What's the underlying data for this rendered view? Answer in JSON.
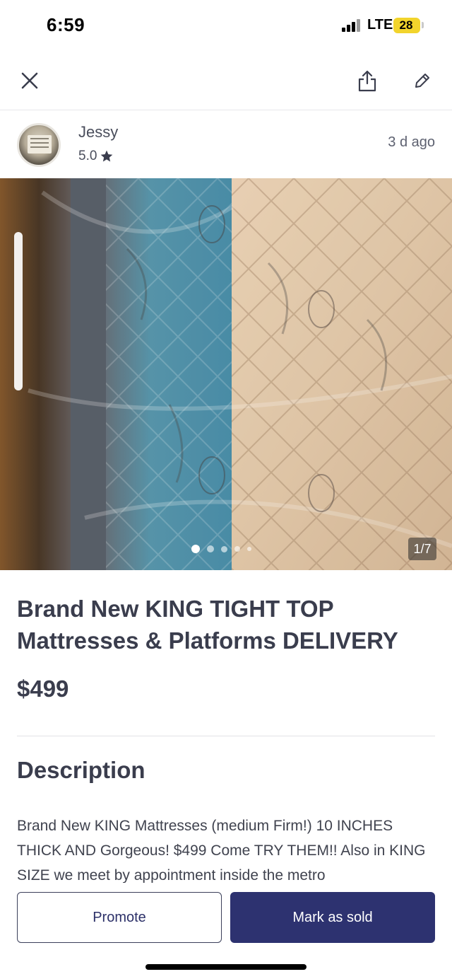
{
  "status_bar": {
    "time": "6:59",
    "network": "LTE",
    "battery": "28"
  },
  "nav": {
    "close_icon": "close-icon",
    "share_icon": "share-icon",
    "edit_icon": "pencil-icon"
  },
  "seller": {
    "name": "Jessy",
    "rating": "5.0",
    "posted": "3 d ago"
  },
  "photo": {
    "counter": "1/7",
    "dot_count": 5,
    "active_dot": 0
  },
  "listing": {
    "title": "Brand New KING TIGHT TOP Mattresses & Platforms DELIVERY",
    "price": "$499"
  },
  "description": {
    "heading": "Description",
    "body": "Brand New KING Mattresses (medium Firm!) 10 INCHES THICK AND Gorgeous! $499 Come TRY THEM!! Also in KING SIZE we meet by appointment inside the metro"
  },
  "actions": {
    "promote_label": "Promote",
    "mark_sold_label": "Mark as sold"
  },
  "colors": {
    "primary": "#2d3270",
    "text": "#3a3d4d",
    "battery": "#f2d42c"
  }
}
